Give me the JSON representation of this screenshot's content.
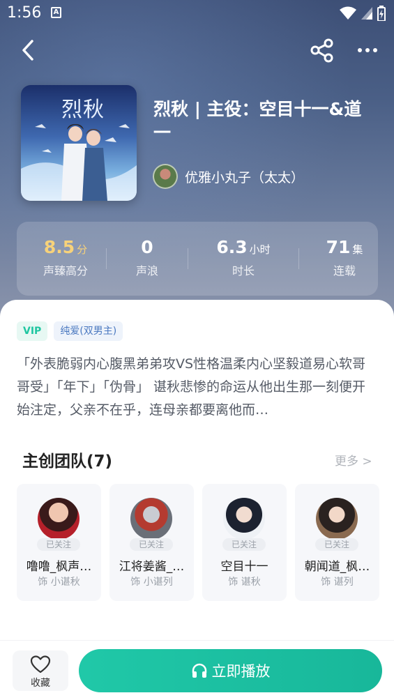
{
  "status": {
    "time": "1:56",
    "notif": "A"
  },
  "header": {
    "title": "烈秋 | 主役：空目十一&道一",
    "cover_title": "烈秋",
    "author_name": "优雅小丸子（太太）"
  },
  "stats": [
    {
      "value": "8.5",
      "unit": "分",
      "label": "声臻高分"
    },
    {
      "value": "0",
      "unit": "",
      "label": "声浪"
    },
    {
      "value": "6.3",
      "unit": "小时",
      "label": "时长"
    },
    {
      "value": "71",
      "unit": "集",
      "label": "连载"
    }
  ],
  "tags": {
    "vip": "VIP",
    "genre": "纯爱(双男主)"
  },
  "description": "「外表脆弱内心腹黑弟弟攻VS性格温柔内心坚毅道易心软哥哥受」「年下」「伪骨」 谌秋悲惨的命运从他出生那一刻便开始注定，父亲不在乎，连母亲都要离他而…",
  "team": {
    "title": "主创团队(7)",
    "more": "更多 >",
    "members": [
      {
        "name": "噜噜_枫声…",
        "role": "饰 小谌秋",
        "followed": "已关注"
      },
      {
        "name": "江将姜酱_…",
        "role": "饰 小谌列",
        "followed": "已关注"
      },
      {
        "name": "空目十一",
        "role": "饰 谌秋",
        "followed": "已关注"
      },
      {
        "name": "朝闻道_枫…",
        "role": "饰 谌列",
        "followed": "已关注"
      }
    ]
  },
  "bottom": {
    "fav_label": "收藏",
    "play_label": "立即播放"
  },
  "colors": {
    "accent": "#1fc6a1",
    "gold": "#f7d27a"
  }
}
